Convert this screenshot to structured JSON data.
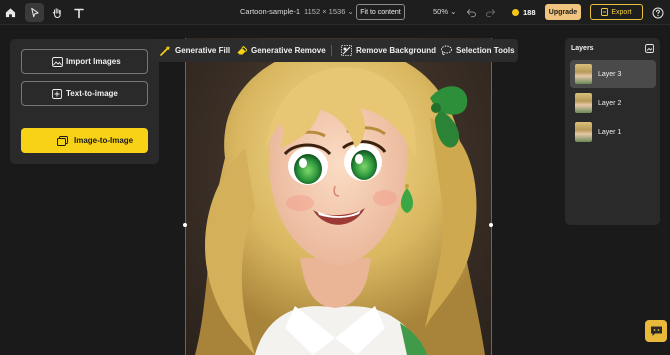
{
  "topbar": {
    "document_name": "Cartoon-sample-1",
    "dimensions": "1152 × 1536",
    "fit_label": "Fit to content",
    "zoom": "50%",
    "credits": "188",
    "upgrade_label": "Upgrade",
    "export_label": "Export",
    "icons": [
      "home-icon",
      "pointer-icon",
      "hand-icon",
      "text-icon",
      "undo-icon",
      "redo-icon",
      "help-icon"
    ]
  },
  "left_panel": {
    "import_label": "Import Images",
    "text_to_image_label": "Text-to-image",
    "image_to_image_label": "Image-to-Image"
  },
  "toolbar": {
    "generative_fill": "Generative Fill",
    "generative_remove": "Generative Remove",
    "remove_background": "Remove Background",
    "selection_tools": "Selection Tools"
  },
  "layers": {
    "title": "Layers",
    "items": [
      {
        "label": "Layer 3",
        "selected": true
      },
      {
        "label": "Layer 2",
        "selected": false
      },
      {
        "label": "Layer 1",
        "selected": false
      }
    ]
  },
  "colors": {
    "accent_yellow": "#f7d216",
    "upgrade_bg": "#f0c47e",
    "export_border": "#e8c23a",
    "panel_bg": "#2a2a2a",
    "app_bg": "#1a1a1a"
  }
}
